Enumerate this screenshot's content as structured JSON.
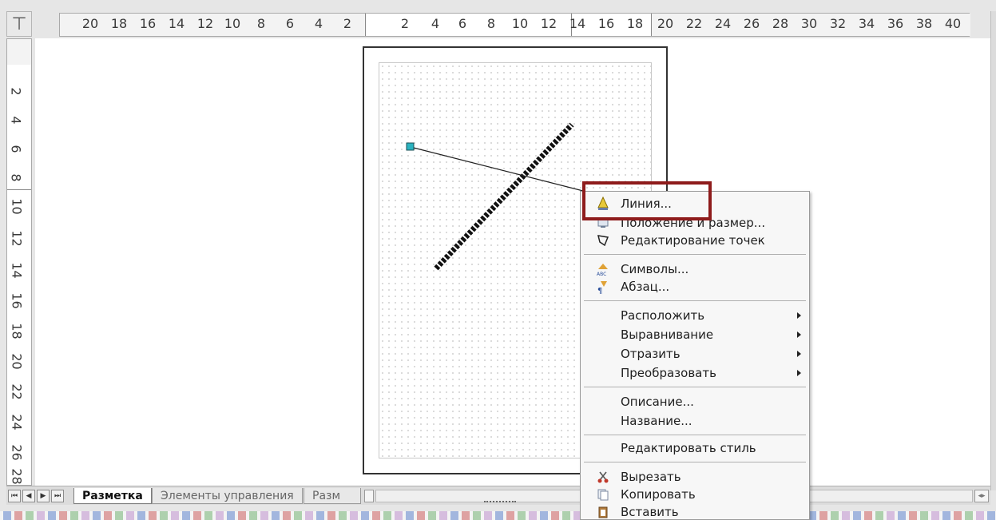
{
  "rulers": {
    "horizontal_labels": [
      "20",
      "18",
      "16",
      "14",
      "12",
      "10",
      "8",
      "6",
      "4",
      "2",
      "2",
      "4",
      "6",
      "8",
      "10",
      "12",
      "14",
      "16",
      "18",
      "20",
      "22",
      "24",
      "26",
      "28",
      "30",
      "32",
      "34",
      "36",
      "38",
      "40"
    ],
    "vertical_labels": [
      "2",
      "4",
      "6",
      "8",
      "10",
      "12",
      "14",
      "16",
      "18",
      "20",
      "22",
      "24",
      "26",
      "28"
    ]
  },
  "context_menu": {
    "items": [
      {
        "label": "Линия...",
        "icon": "line-properties-icon"
      },
      {
        "label": "Положение и размер...",
        "icon": "position-size-icon"
      },
      {
        "label": "Редактирование точек",
        "icon": "edit-points-icon"
      },
      {
        "label": "Символы...",
        "icon": "characters-icon"
      },
      {
        "label": "Абзац...",
        "icon": "paragraph-icon"
      },
      {
        "label": "Расположить",
        "submenu": true
      },
      {
        "label": "Выравнивание",
        "submenu": true
      },
      {
        "label": "Отразить",
        "submenu": true
      },
      {
        "label": "Преобразовать",
        "submenu": true
      },
      {
        "label": "Описание..."
      },
      {
        "label": "Название..."
      },
      {
        "label": "Редактировать стиль"
      },
      {
        "label": "Вырезать",
        "icon": "scissors-icon"
      },
      {
        "label": "Копировать",
        "icon": "copy-icon"
      },
      {
        "label": "Вставить",
        "icon": "paste-icon"
      }
    ]
  },
  "tabs": {
    "active": "Разметка",
    "controls": "Элементы управления",
    "dimensions": "Разм"
  },
  "colors": {
    "highlight": "#8e1b1b",
    "handle": "#2bb3c0",
    "thick_line": "#111111"
  }
}
